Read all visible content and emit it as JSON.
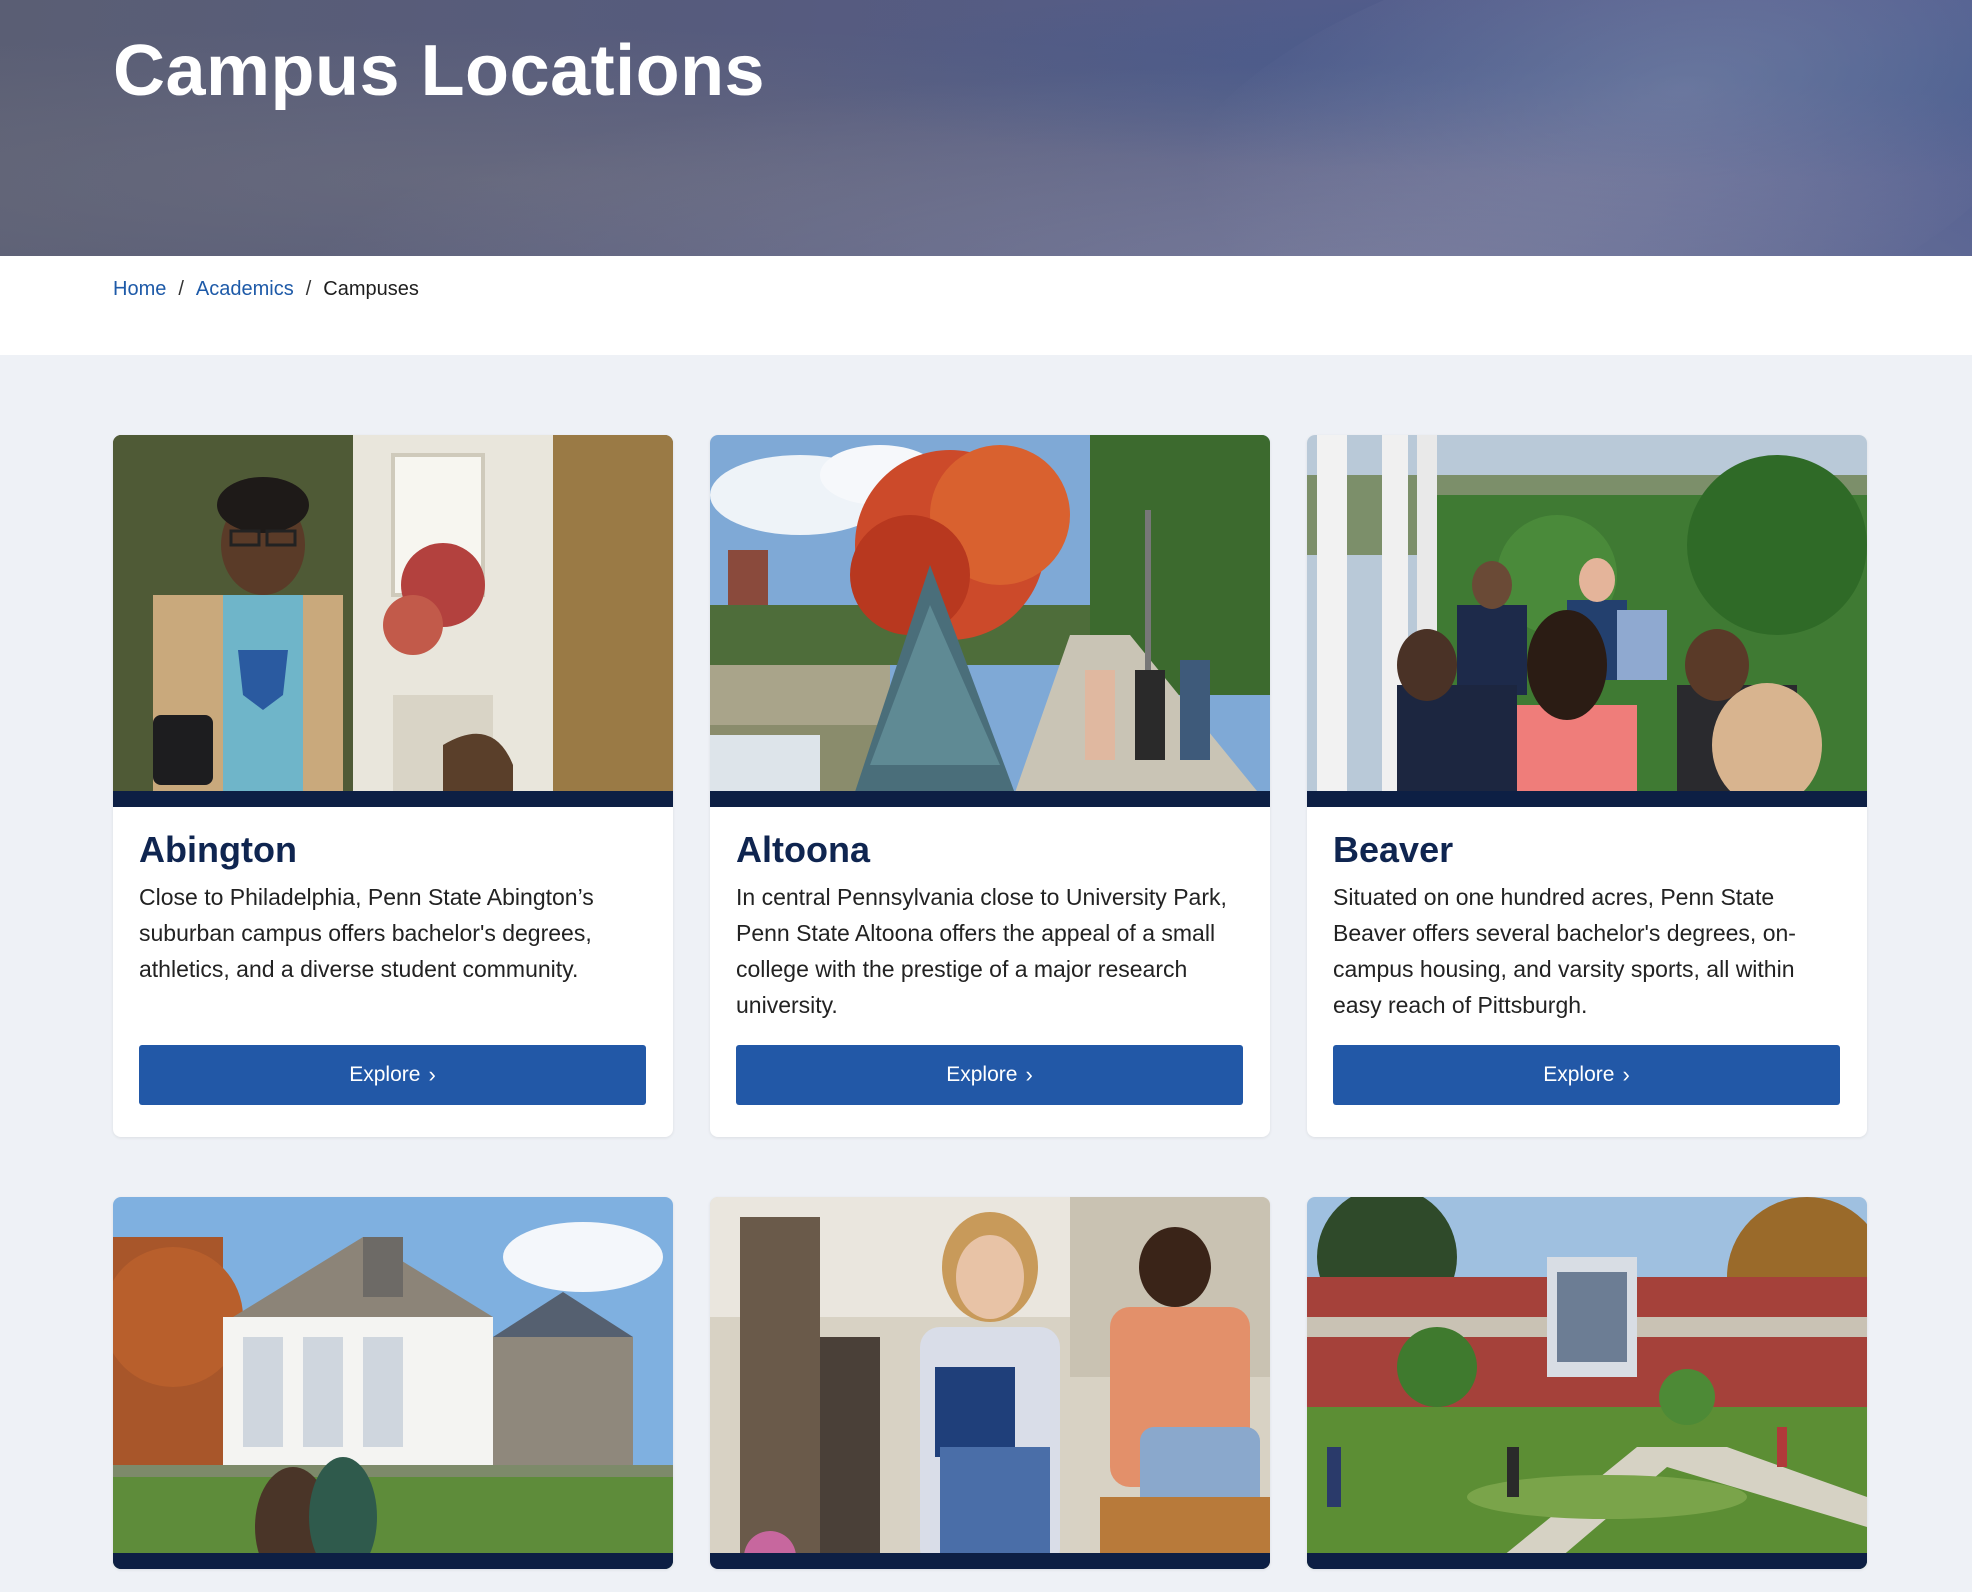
{
  "hero": {
    "title": "Campus Locations"
  },
  "breadcrumb": {
    "items": [
      {
        "label": "Home"
      },
      {
        "label": "Academics"
      },
      {
        "label": "Campuses"
      }
    ],
    "separator": "/"
  },
  "cards": [
    {
      "name": "Abington",
      "description": "Close to Philadelphia, Penn State Abington’s suburban campus offers bachelor's degrees, athletics, and a diverse student community.",
      "button": "Explore",
      "image_alt": "Student smiling outside a building"
    },
    {
      "name": "Altoona",
      "description": "In central Pennsylvania close to University Park, Penn State Altoona offers the appeal of a small college with the prestige of a major research university.",
      "button": "Explore",
      "image_alt": "Students walking by a lake in autumn"
    },
    {
      "name": "Beaver",
      "description": "Situated on one hundred acres, Penn State Beaver offers several bachelor's degrees, on-campus housing, and varsity sports, all within easy reach of Pittsburgh.",
      "button": "Explore",
      "image_alt": "Students studying at outdoor tables"
    },
    {
      "name": "",
      "description": "",
      "button": "",
      "image_alt": "White clubhouse building with lawn"
    },
    {
      "name": "",
      "description": "",
      "button": "",
      "image_alt": "Two students talking near a fountain"
    },
    {
      "name": "",
      "description": "",
      "button": "",
      "image_alt": "Campus walkways and brick building"
    }
  ],
  "colors": {
    "brand_navy": "#0d1f44",
    "button_blue": "#2258a7",
    "link_blue": "#1e5aa8",
    "page_bg": "#eef1f6"
  },
  "icons": {
    "explore_chevron": "chevron-right-icon"
  }
}
